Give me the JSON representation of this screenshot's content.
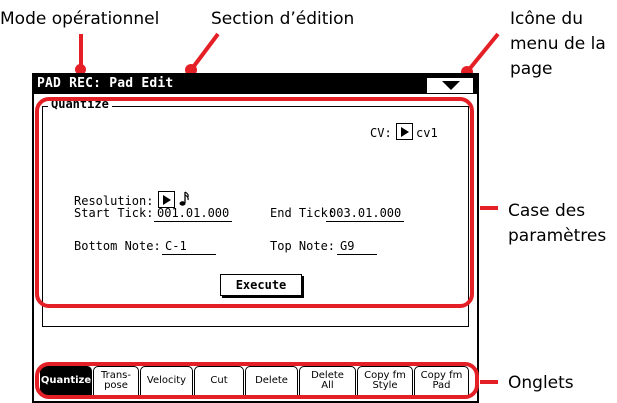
{
  "callouts": {
    "mode": "Mode opérationnel",
    "section": "Section d’édition",
    "menu_icon_line1": "Icône du",
    "menu_icon_line2": "menu de la",
    "menu_icon_line3": "page",
    "params_line1": "Case des",
    "params_line2": "paramètres",
    "tabs": "Onglets",
    "accent_color": "#e41f26"
  },
  "screen": {
    "title": "PAD REC: Pad Edit",
    "group_label": "Quantize",
    "cv_label": "CV:",
    "cv_value": "cv1",
    "resolution_label": "Resolution:",
    "resolution_value_icon": "sixteenth-note-icon",
    "start_tick_label": "Start Tick:",
    "start_tick_value": "001.01.000",
    "end_tick_label": "End Tick:",
    "end_tick_value": "003.01.000",
    "bottom_note_label": "Bottom Note:",
    "bottom_note_value": "C-1",
    "top_note_label": "Top Note:",
    "top_note_value": "G9",
    "execute_label": "Execute"
  },
  "tabs": [
    {
      "label1": "Quantize",
      "label2": ""
    },
    {
      "label1": "Trans-",
      "label2": "pose"
    },
    {
      "label1": "Velocity",
      "label2": ""
    },
    {
      "label1": "Cut",
      "label2": ""
    },
    {
      "label1": "Delete",
      "label2": ""
    },
    {
      "label1": "Delete",
      "label2": "All"
    },
    {
      "label1": "Copy fm",
      "label2": "Style"
    },
    {
      "label1": "Copy fm",
      "label2": "Pad"
    }
  ]
}
